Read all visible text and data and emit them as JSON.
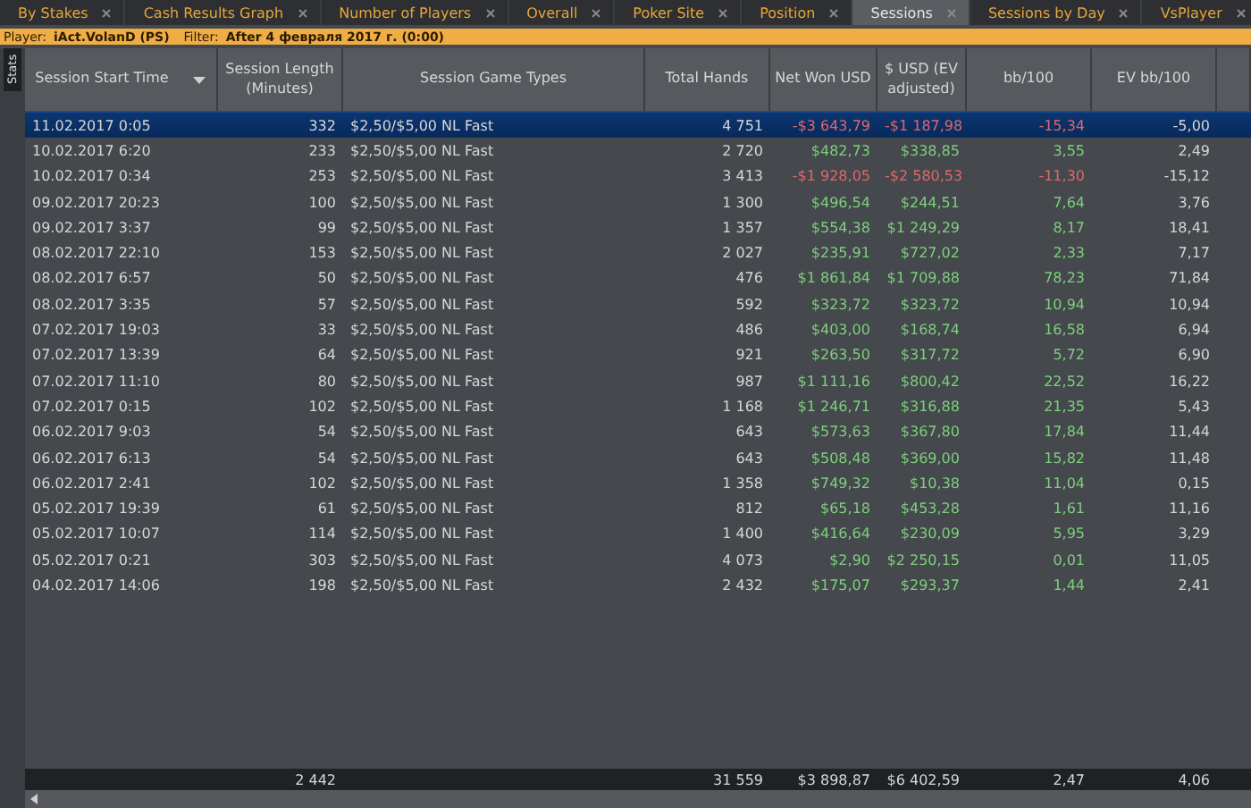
{
  "tabs": [
    {
      "label": "By Stakes",
      "selected": false
    },
    {
      "label": "Cash Results Graph",
      "selected": false
    },
    {
      "label": "Number of Players",
      "selected": false
    },
    {
      "label": "Overall",
      "selected": false
    },
    {
      "label": "Poker Site",
      "selected": false
    },
    {
      "label": "Position",
      "selected": false
    },
    {
      "label": "Sessions",
      "selected": true
    },
    {
      "label": "Sessions by Day",
      "selected": false
    },
    {
      "label": "VsPlayer",
      "selected": false
    }
  ],
  "filter_bar": {
    "player_label": "Player:",
    "player": "iAct.VolanD (PS)",
    "filter_label": "Filter:",
    "filter": "After 4 февраля 2017 г. (0:00)"
  },
  "side_tab": "Stats",
  "table": {
    "columns": [
      "Session Start Time",
      "Session Length (Minutes)",
      "Session Game Types",
      "Total Hands",
      "Net Won USD",
      "$ USD (EV adjusted)",
      "bb/100",
      "EV bb/100"
    ],
    "rows": [
      {
        "start": "11.02.2017 0:05",
        "length": "332",
        "game": "$2,50/$5,00 NL Fast",
        "hands": "4 751",
        "net": "-$3 643,79",
        "ev_usd": "-$1 187,98",
        "bb100": "-15,34",
        "ev_bb100": "-5,00",
        "loss": true,
        "ev_loss": true,
        "selected": true
      },
      {
        "start": "10.02.2017 6:20",
        "length": "233",
        "game": "$2,50/$5,00 NL Fast",
        "hands": "2 720",
        "net": "$482,73",
        "ev_usd": "$338,85",
        "bb100": "3,55",
        "ev_bb100": "2,49",
        "loss": false,
        "ev_loss": false,
        "selected": false
      },
      {
        "start": "10.02.2017 0:34",
        "length": "253",
        "game": "$2,50/$5,00 NL Fast",
        "hands": "3 413",
        "net": "-$1 928,05",
        "ev_usd": "-$2 580,53",
        "bb100": "-11,30",
        "ev_bb100": "-15,12",
        "loss": true,
        "ev_loss": true,
        "selected": false
      },
      {
        "start": "09.02.2017 20:23",
        "length": "100",
        "game": "$2,50/$5,00 NL Fast",
        "hands": "1 300",
        "net": "$496,54",
        "ev_usd": "$244,51",
        "bb100": "7,64",
        "ev_bb100": "3,76",
        "loss": false,
        "ev_loss": false,
        "selected": false
      },
      {
        "start": "09.02.2017 3:37",
        "length": "99",
        "game": "$2,50/$5,00 NL Fast",
        "hands": "1 357",
        "net": "$554,38",
        "ev_usd": "$1 249,29",
        "bb100": "8,17",
        "ev_bb100": "18,41",
        "loss": false,
        "ev_loss": false,
        "selected": false
      },
      {
        "start": "08.02.2017 22:10",
        "length": "153",
        "game": "$2,50/$5,00 NL Fast",
        "hands": "2 027",
        "net": "$235,91",
        "ev_usd": "$727,02",
        "bb100": "2,33",
        "ev_bb100": "7,17",
        "loss": false,
        "ev_loss": false,
        "selected": false
      },
      {
        "start": "08.02.2017 6:57",
        "length": "50",
        "game": "$2,50/$5,00 NL Fast",
        "hands": "476",
        "net": "$1 861,84",
        "ev_usd": "$1 709,88",
        "bb100": "78,23",
        "ev_bb100": "71,84",
        "loss": false,
        "ev_loss": false,
        "selected": false
      },
      {
        "start": "08.02.2017 3:35",
        "length": "57",
        "game": "$2,50/$5,00 NL Fast",
        "hands": "592",
        "net": "$323,72",
        "ev_usd": "$323,72",
        "bb100": "10,94",
        "ev_bb100": "10,94",
        "loss": false,
        "ev_loss": false,
        "selected": false
      },
      {
        "start": "07.02.2017 19:03",
        "length": "33",
        "game": "$2,50/$5,00 NL Fast",
        "hands": "486",
        "net": "$403,00",
        "ev_usd": "$168,74",
        "bb100": "16,58",
        "ev_bb100": "6,94",
        "loss": false,
        "ev_loss": false,
        "selected": false
      },
      {
        "start": "07.02.2017 13:39",
        "length": "64",
        "game": "$2,50/$5,00 NL Fast",
        "hands": "921",
        "net": "$263,50",
        "ev_usd": "$317,72",
        "bb100": "5,72",
        "ev_bb100": "6,90",
        "loss": false,
        "ev_loss": false,
        "selected": false
      },
      {
        "start": "07.02.2017 11:10",
        "length": "80",
        "game": "$2,50/$5,00 NL Fast",
        "hands": "987",
        "net": "$1 111,16",
        "ev_usd": "$800,42",
        "bb100": "22,52",
        "ev_bb100": "16,22",
        "loss": false,
        "ev_loss": false,
        "selected": false
      },
      {
        "start": "07.02.2017 0:15",
        "length": "102",
        "game": "$2,50/$5,00 NL Fast",
        "hands": "1 168",
        "net": "$1 246,71",
        "ev_usd": "$316,88",
        "bb100": "21,35",
        "ev_bb100": "5,43",
        "loss": false,
        "ev_loss": false,
        "selected": false
      },
      {
        "start": "06.02.2017 9:03",
        "length": "54",
        "game": "$2,50/$5,00 NL Fast",
        "hands": "643",
        "net": "$573,63",
        "ev_usd": "$367,80",
        "bb100": "17,84",
        "ev_bb100": "11,44",
        "loss": false,
        "ev_loss": false,
        "selected": false
      },
      {
        "start": "06.02.2017 6:13",
        "length": "54",
        "game": "$2,50/$5,00 NL Fast",
        "hands": "643",
        "net": "$508,48",
        "ev_usd": "$369,00",
        "bb100": "15,82",
        "ev_bb100": "11,48",
        "loss": false,
        "ev_loss": false,
        "selected": false
      },
      {
        "start": "06.02.2017 2:41",
        "length": "102",
        "game": "$2,50/$5,00 NL Fast",
        "hands": "1 358",
        "net": "$749,32",
        "ev_usd": "$10,38",
        "bb100": "11,04",
        "ev_bb100": "0,15",
        "loss": false,
        "ev_loss": false,
        "selected": false
      },
      {
        "start": "05.02.2017 19:39",
        "length": "61",
        "game": "$2,50/$5,00 NL Fast",
        "hands": "812",
        "net": "$65,18",
        "ev_usd": "$453,28",
        "bb100": "1,61",
        "ev_bb100": "11,16",
        "loss": false,
        "ev_loss": false,
        "selected": false
      },
      {
        "start": "05.02.2017 10:07",
        "length": "114",
        "game": "$2,50/$5,00 NL Fast",
        "hands": "1 400",
        "net": "$416,64",
        "ev_usd": "$230,09",
        "bb100": "5,95",
        "ev_bb100": "3,29",
        "loss": false,
        "ev_loss": false,
        "selected": false
      },
      {
        "start": "05.02.2017 0:21",
        "length": "303",
        "game": "$2,50/$5,00 NL Fast",
        "hands": "4 073",
        "net": "$2,90",
        "ev_usd": "$2 250,15",
        "bb100": "0,01",
        "ev_bb100": "11,05",
        "loss": false,
        "ev_loss": false,
        "selected": false
      },
      {
        "start": "04.02.2017 14:06",
        "length": "198",
        "game": "$2,50/$5,00 NL Fast",
        "hands": "2 432",
        "net": "$175,07",
        "ev_usd": "$293,37",
        "bb100": "1,44",
        "ev_bb100": "2,41",
        "loss": false,
        "ev_loss": false,
        "selected": false
      }
    ],
    "totals": {
      "length": "2 442",
      "hands": "31 559",
      "net": "$3 898,87",
      "ev_usd": "$6 402,59",
      "bb100": "2,47",
      "ev_bb100": "4,06"
    }
  }
}
